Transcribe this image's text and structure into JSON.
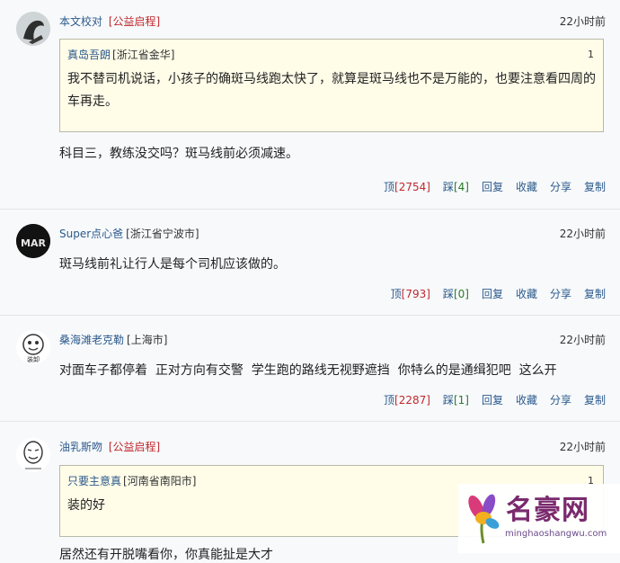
{
  "comments": [
    {
      "user": "本文校对",
      "tag": "[公益启程]",
      "time": "22小时前",
      "quote": {
        "user": "真岛吾朗",
        "location": "[浙江省金华]",
        "floor": "1",
        "text": "我不替司机说话，小孩子的确斑马线跑太快了，就算是斑马线也不是万能的，也要注意看四周的车再走。"
      },
      "text": "科目三，教练没交吗？斑马线前必须减速。",
      "actions": {
        "up_label": "顶",
        "up_count": "[2754]",
        "down_label": "踩",
        "down_count": "[4]",
        "reply": "回复",
        "fav": "收藏",
        "share": "分享",
        "copy": "复制"
      }
    },
    {
      "user": "Super点心爸",
      "location": "[浙江省宁波市]",
      "time": "22小时前",
      "text": "斑马线前礼让行人是每个司机应该做的。",
      "actions": {
        "up_label": "顶",
        "up_count": "[793]",
        "down_label": "踩",
        "down_count": "[0]",
        "reply": "回复",
        "fav": "收藏",
        "share": "分享",
        "copy": "复制"
      }
    },
    {
      "user": "桑海滩老克勒",
      "location": "[上海市]",
      "time": "22小时前",
      "text": "对面车子都停着  正对方向有交警  学生跑的路线无视野遮挡  你特么的是通缉犯吧  这么开",
      "actions": {
        "up_label": "顶",
        "up_count": "[2287]",
        "down_label": "踩",
        "down_count": "[1]",
        "reply": "回复",
        "fav": "收藏",
        "share": "分享",
        "copy": "复制"
      }
    },
    {
      "user": "油乳斯吻",
      "tag": "[公益启程]",
      "time": "22小时前",
      "quote": {
        "user": "只要主意真",
        "location": "[河南省南阳市]",
        "floor": "1",
        "text": "装的好"
      },
      "text": "居然还有开脱嘴看你，你真能扯是大才"
    }
  ],
  "avatars": {
    "a2_text": "MAR",
    "a3_text": "装卸"
  },
  "watermark": {
    "title": "名豪网",
    "url": "minghaoshangwu.com"
  }
}
